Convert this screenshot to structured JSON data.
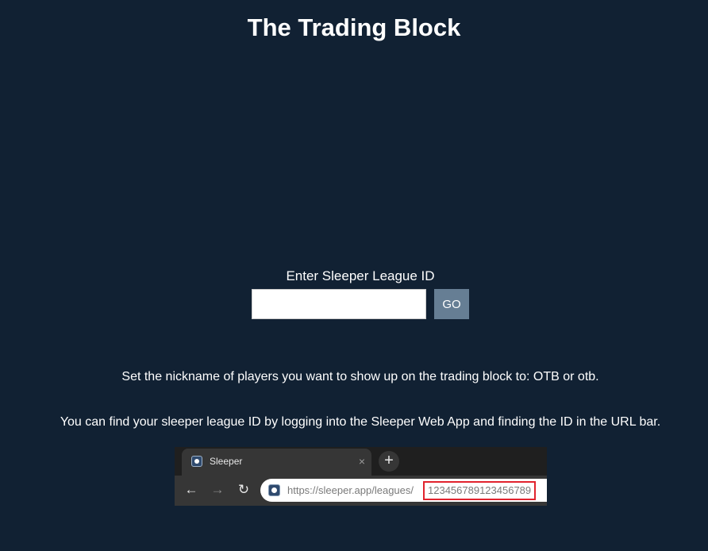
{
  "header": {
    "title": "The Trading Block"
  },
  "form": {
    "label": "Enter Sleeper League ID",
    "input_value": "",
    "input_placeholder": "",
    "go_label": "GO"
  },
  "info": {
    "nickname_text": "Set the nickname of players you want to show up on the trading block to: OTB or otb.",
    "find_id_text": "You can find your sleeper league ID by logging into the Sleeper Web App and finding the ID in the URL bar."
  },
  "illustration": {
    "tab_title": "Sleeper",
    "tab_close": "×",
    "new_tab": "+",
    "back": "←",
    "forward": "→",
    "reload": "↻",
    "url_base": "https://sleeper.app/leagues/",
    "url_id": "123456789123456789",
    "highlight_color": "#e1232e"
  },
  "colors": {
    "background": "#112133",
    "button": "#667e94"
  }
}
